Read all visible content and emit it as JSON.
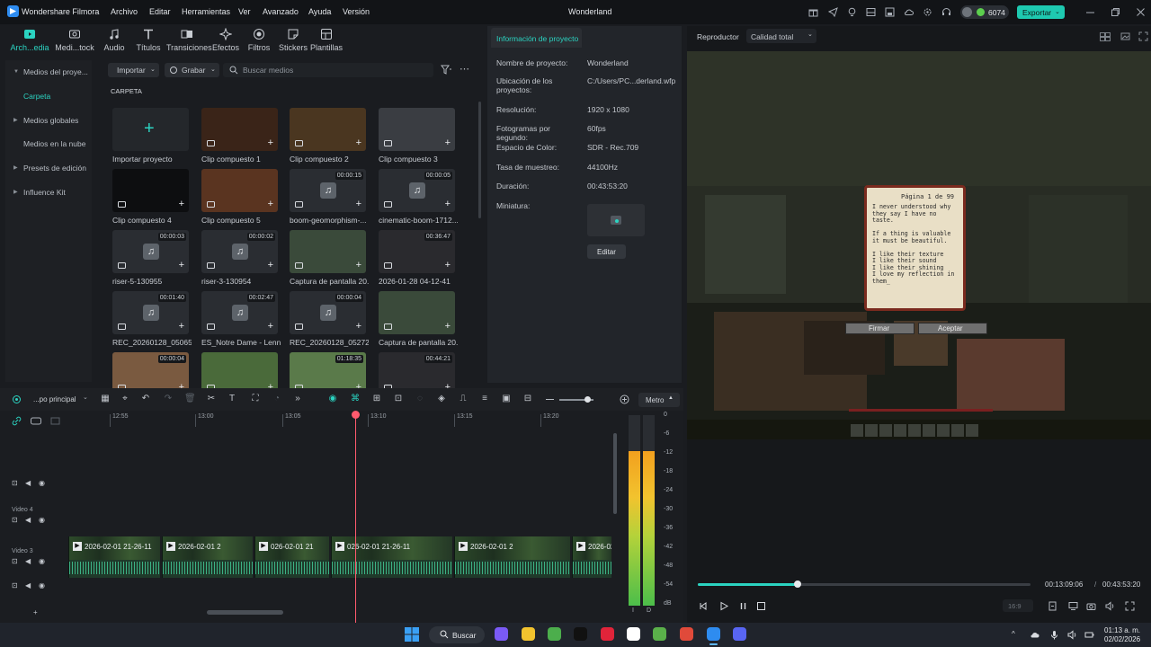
{
  "app": {
    "name": "Wondershare Filmora",
    "project_title": "Wonderland",
    "credits": "6074",
    "export_label": "Exportar"
  },
  "menu": [
    "Archivo",
    "Editar",
    "Herramientas",
    "Ver",
    "Avanzado",
    "Ayuda",
    "Versión"
  ],
  "toolbar": [
    "Arch...edia",
    "Medi...tock",
    "Audio",
    "Títulos",
    "Transiciones",
    "Efectos",
    "Filtros",
    "Stickers",
    "Plantillas"
  ],
  "sidebar": {
    "items": [
      {
        "label": "Medios del proye...",
        "arrow": true
      },
      {
        "label": "Carpeta",
        "arrow": false
      },
      {
        "label": "Medios globales",
        "arrow": true
      },
      {
        "label": "Medios en la nube",
        "arrow": false
      },
      {
        "label": "Presets de edición",
        "arrow": true
      },
      {
        "label": "Influence Kit",
        "arrow": true
      }
    ]
  },
  "media": {
    "import_label": "Importar",
    "record_label": "Grabar",
    "search_placeholder": "Buscar medios",
    "folder_title": "CARPETA",
    "items": [
      {
        "caption": "Importar proyecto",
        "duration": "",
        "kind": "import"
      },
      {
        "caption": "Clip compuesto 1",
        "duration": "",
        "kind": "compound"
      },
      {
        "caption": "Clip compuesto 2",
        "duration": "",
        "kind": "compound"
      },
      {
        "caption": "Clip compuesto 3",
        "duration": "",
        "kind": "compound"
      },
      {
        "caption": "Clip compuesto 4",
        "duration": "",
        "kind": "compound"
      },
      {
        "caption": "Clip compuesto 5",
        "duration": "",
        "kind": "compound"
      },
      {
        "caption": "boom-geomorphism-...",
        "duration": "00:00:15",
        "kind": "audio"
      },
      {
        "caption": "cinematic-boom-1712...",
        "duration": "00:00:05",
        "kind": "audio"
      },
      {
        "caption": "riser-5-130955",
        "duration": "00:00:03",
        "kind": "audio"
      },
      {
        "caption": "riser-3-130954",
        "duration": "00:00:02",
        "kind": "audio"
      },
      {
        "caption": "Captura de pantalla 20...",
        "duration": "",
        "kind": "image"
      },
      {
        "caption": "2026-01-28 04-12-41",
        "duration": "00:36:47",
        "kind": "video"
      },
      {
        "caption": "REC_20260128_050657",
        "duration": "00:01:40",
        "kind": "audio"
      },
      {
        "caption": "ES_Notre Dame - Lenn...",
        "duration": "00:02:47",
        "kind": "audio"
      },
      {
        "caption": "REC_20260128_052727",
        "duration": "00:00:04",
        "kind": "audio"
      },
      {
        "caption": "Captura de pantalla 20...",
        "duration": "",
        "kind": "image"
      },
      {
        "caption": "",
        "duration": "00:00:04",
        "kind": "video"
      },
      {
        "caption": "",
        "duration": "",
        "kind": "video"
      },
      {
        "caption": "",
        "duration": "01:18:35",
        "kind": "video"
      },
      {
        "caption": "",
        "duration": "00:44:21",
        "kind": "video"
      }
    ]
  },
  "project_info": {
    "tab_label": "Información de proyecto",
    "rows": [
      {
        "label": "Nombre de proyecto:",
        "value": "Wonderland"
      },
      {
        "label": "Ubicación de los proyectos:",
        "value": "C:/Users/PC...derland.wfp"
      },
      {
        "label": "Resolución:",
        "value": "1920 x 1080"
      },
      {
        "label": "Fotogramas por segundo:",
        "value": "60fps"
      },
      {
        "label": "Espacio de Color:",
        "value": "SDR - Rec.709"
      },
      {
        "label": "Tasa de muestreo:",
        "value": "44100Hz"
      },
      {
        "label": "Duración:",
        "value": "00:43:53:20"
      },
      {
        "label": "Miniatura:",
        "value": ""
      }
    ],
    "edit_label": "Editar"
  },
  "player": {
    "label": "Reproductor",
    "quality": "Calidad total",
    "current_time": "00:13:09:06",
    "total_time": "00:43:53:20",
    "progress": 0.3,
    "aspect": "16:9",
    "book": {
      "page": "Página 1 de 99",
      "text": "I never understood why they say I have no taste.\n\nIf a thing is valuable it must be beautiful.\n\nI like their texture\nI like their sound\nI like their shining\nI love my reflection in them_",
      "sign_label": "Firmar",
      "accept_label": "Aceptar"
    }
  },
  "timeline": {
    "sequence_label": "...po principal",
    "meter_label": "Metro",
    "ruler": [
      "12:55",
      "13:00",
      "13:05",
      "13:10",
      "13:15",
      "13:20"
    ],
    "tracks": [
      "",
      "Video 4",
      "Video 3",
      ""
    ],
    "clips": [
      {
        "label": "2026-02-01 21-26-11",
        "start": 0
      },
      {
        "label": "2026-02-01 2",
        "start": 1
      },
      {
        "label": "026-02-01 21",
        "start": 2
      },
      {
        "label": "026-02-01 21-26-11",
        "start": 3
      },
      {
        "label": "2026-02-01 2",
        "start": 4
      },
      {
        "label": "2026-02",
        "start": 5
      }
    ],
    "vu_scale": [
      "0",
      "-6",
      "-12",
      "-18",
      "-24",
      "-30",
      "-36",
      "-42",
      "-48",
      "-54",
      "dB"
    ],
    "vu_channels": [
      "I",
      "D"
    ]
  },
  "taskbar": {
    "search_label": "Buscar",
    "time": "01:13 a. m.",
    "date": "02/02/2026"
  },
  "colors": {
    "accent": "#2bd3c1",
    "playhead": "#ff5a6e",
    "export": "#1ec9b0"
  }
}
